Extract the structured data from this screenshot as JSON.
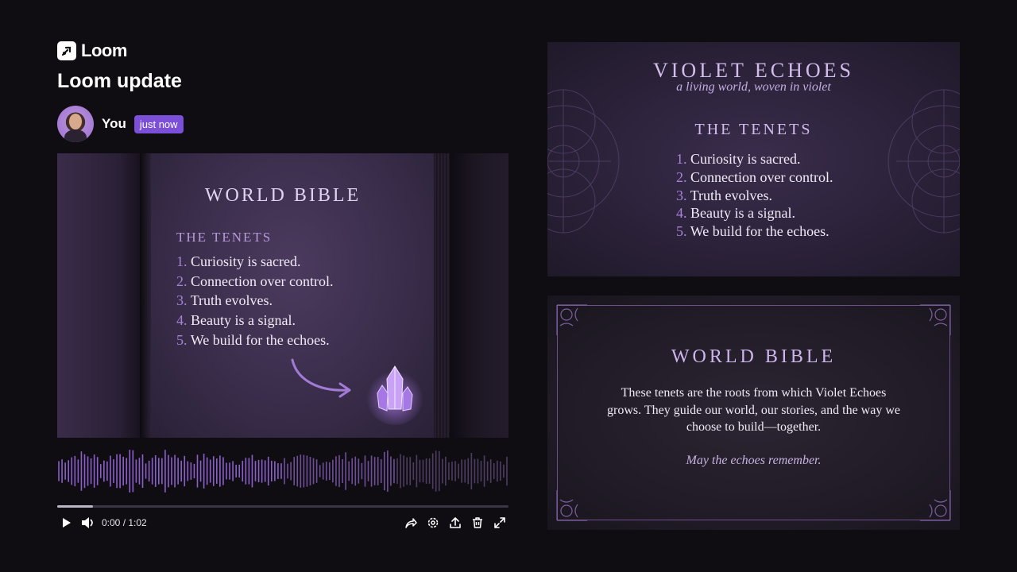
{
  "brand": {
    "name": "Loom"
  },
  "page": {
    "title": "Loom update"
  },
  "author": {
    "name": "You",
    "badge": "just now"
  },
  "video": {
    "title": "WORLD BIBLE",
    "subheading": "THE TENETS",
    "tenets": [
      {
        "num": "1.",
        "text": "Curiosity is sacred."
      },
      {
        "num": "2.",
        "text": "Connection over control."
      },
      {
        "num": "3.",
        "text": "Truth evolves."
      },
      {
        "num": "4.",
        "text": "Beauty is a signal."
      },
      {
        "num": "5.",
        "text": "We build for the echoes."
      }
    ]
  },
  "player": {
    "time": "0:00 / 1:02",
    "progress_fraction": 0.08,
    "icons": [
      "play-icon",
      "volume-icon",
      "share-icon",
      "settings-icon",
      "upload-icon",
      "trash-icon",
      "fullscreen-icon"
    ]
  },
  "card1": {
    "title": "VIOLET ECHOES",
    "subtitle": "a living world, woven in violet",
    "heading": "THE TENETS",
    "tenets": [
      {
        "num": "1.",
        "text": "Curiosity is sacred."
      },
      {
        "num": "2.",
        "text": "Connection over control."
      },
      {
        "num": "3.",
        "text": "Truth evolves."
      },
      {
        "num": "4.",
        "text": "Beauty is a signal."
      },
      {
        "num": "5.",
        "text": "We build for the echoes."
      }
    ]
  },
  "card2": {
    "title": "WORLD BIBLE",
    "body": "These tenets are the roots from which Violet Echoes grows. They guide our world, our stories, and the way we choose to build—together.",
    "motto": "May the echoes remember."
  },
  "colors": {
    "accent": "#7b4fd8",
    "background": "#0f0d12",
    "violet_text": "#a783d6"
  }
}
